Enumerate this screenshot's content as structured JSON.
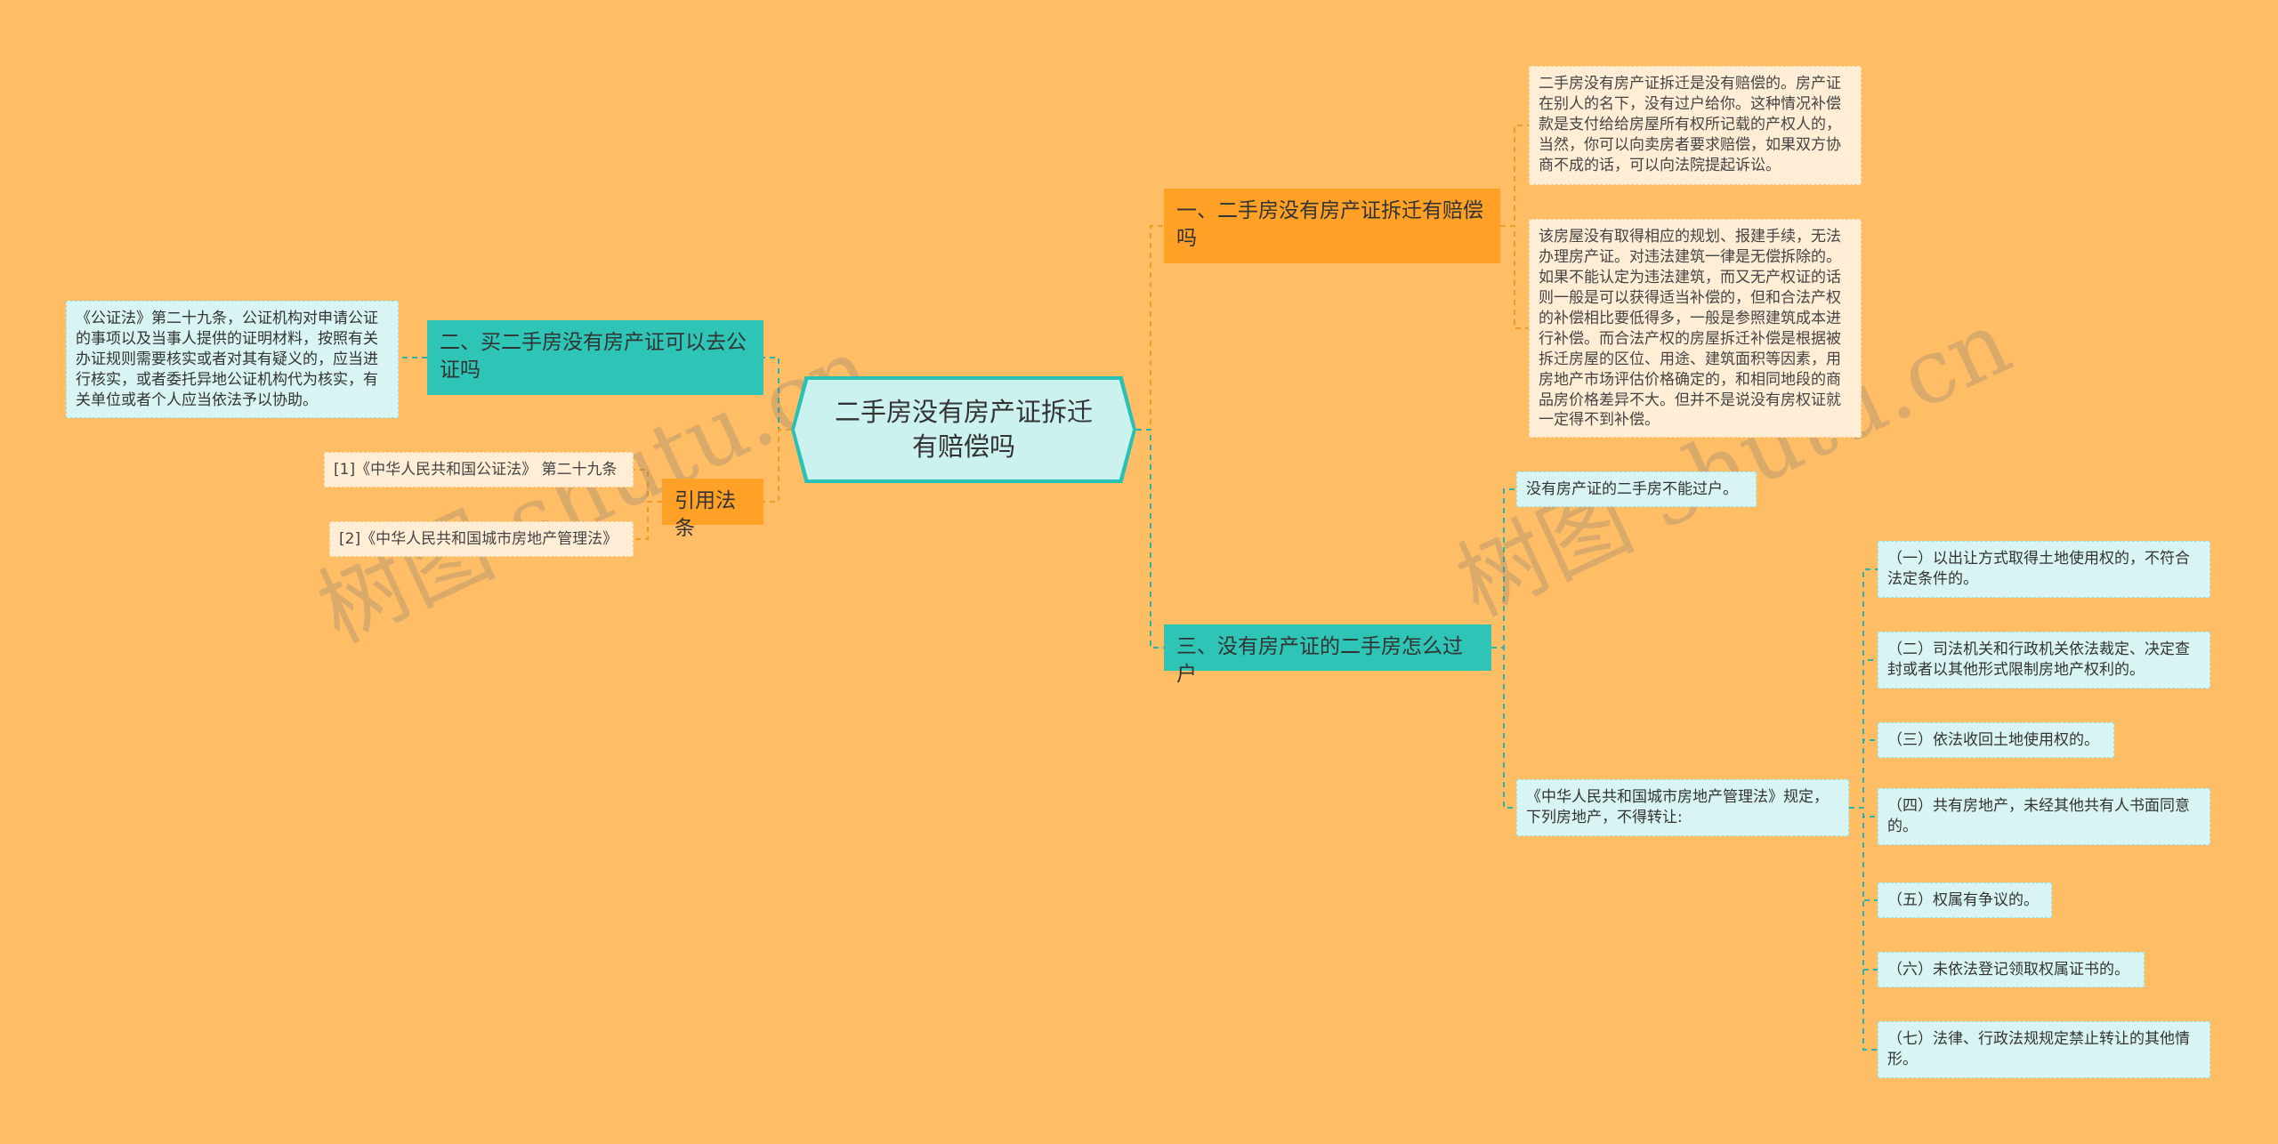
{
  "root": {
    "title": "二手房没有房产证拆迁有赔偿吗"
  },
  "branches": {
    "b1": {
      "title": "一、二手房没有房产证拆迁有赔偿吗",
      "leaves": [
        "二手房没有房产证拆迁是没有赔偿的。房产证在别人的名下，没有过户给你。这种情况补偿款是支付给给房屋所有权所记载的产权人的，当然，你可以向卖房者要求赔偿，如果双方协商不成的话，可以向法院提起诉讼。",
        "该房屋没有取得相应的规划、报建手续，无法办理房产证。对违法建筑一律是无偿拆除的。如果不能认定为违法建筑，而又无产权证的话则一般是可以获得适当补偿的，但和合法产权的补偿相比要低得多，一般是参照建筑成本进行补偿。而合法产权的房屋拆迁补偿是根据被拆迁房屋的区位、用途、建筑面积等因素，用房地产市场评估价格确定的，和相同地段的商品房价格差异不大。但并不是说没有房权证就一定得不到补偿。"
      ]
    },
    "b2": {
      "title": "二、买二手房没有房产证可以去公证吗",
      "leaves": [
        "《公证法》第二十九条，公证机构对申请公证的事项以及当事人提供的证明材料，按照有关办证规则需要核实或者对其有疑义的，应当进行核实，或者委托异地公证机构代为核实，有关单位或者个人应当依法予以协助。"
      ]
    },
    "b3": {
      "title": "三、没有房产证的二手房怎么过户",
      "child1": "没有房产证的二手房不能过户。",
      "child2": "《中华人民共和国城市房地产管理法》规定，下列房地产，不得转让:",
      "items": [
        "（一）以出让方式取得土地使用权的，不符合法定条件的。",
        "（二）司法机关和行政机关依法裁定、决定查封或者以其他形式限制房地产权利的。",
        "（三）依法收回土地使用权的。",
        "（四）共有房地产，未经其他共有人书面同意的。",
        "（五）权属有争议的。",
        "（六）未依法登记领取权属证书的。",
        "（七）法律、行政法规规定禁止转让的其他情形。"
      ]
    },
    "b4": {
      "title": "引用法条",
      "leaves": [
        "[1]《中华人民共和国公证法》 第二十九条",
        "[2]《中华人民共和国城市房地产管理法》"
      ]
    }
  },
  "watermark": {
    "text": "树图 shutu.cn"
  },
  "colors": {
    "background": "#FFBE66",
    "orange": "#FFA126",
    "teal": "#2EC4B6",
    "cream": "#FFEED5",
    "cyan": "#D8F5F3",
    "line_orange": "#F39A2B",
    "line_teal": "#2AB3A6"
  }
}
